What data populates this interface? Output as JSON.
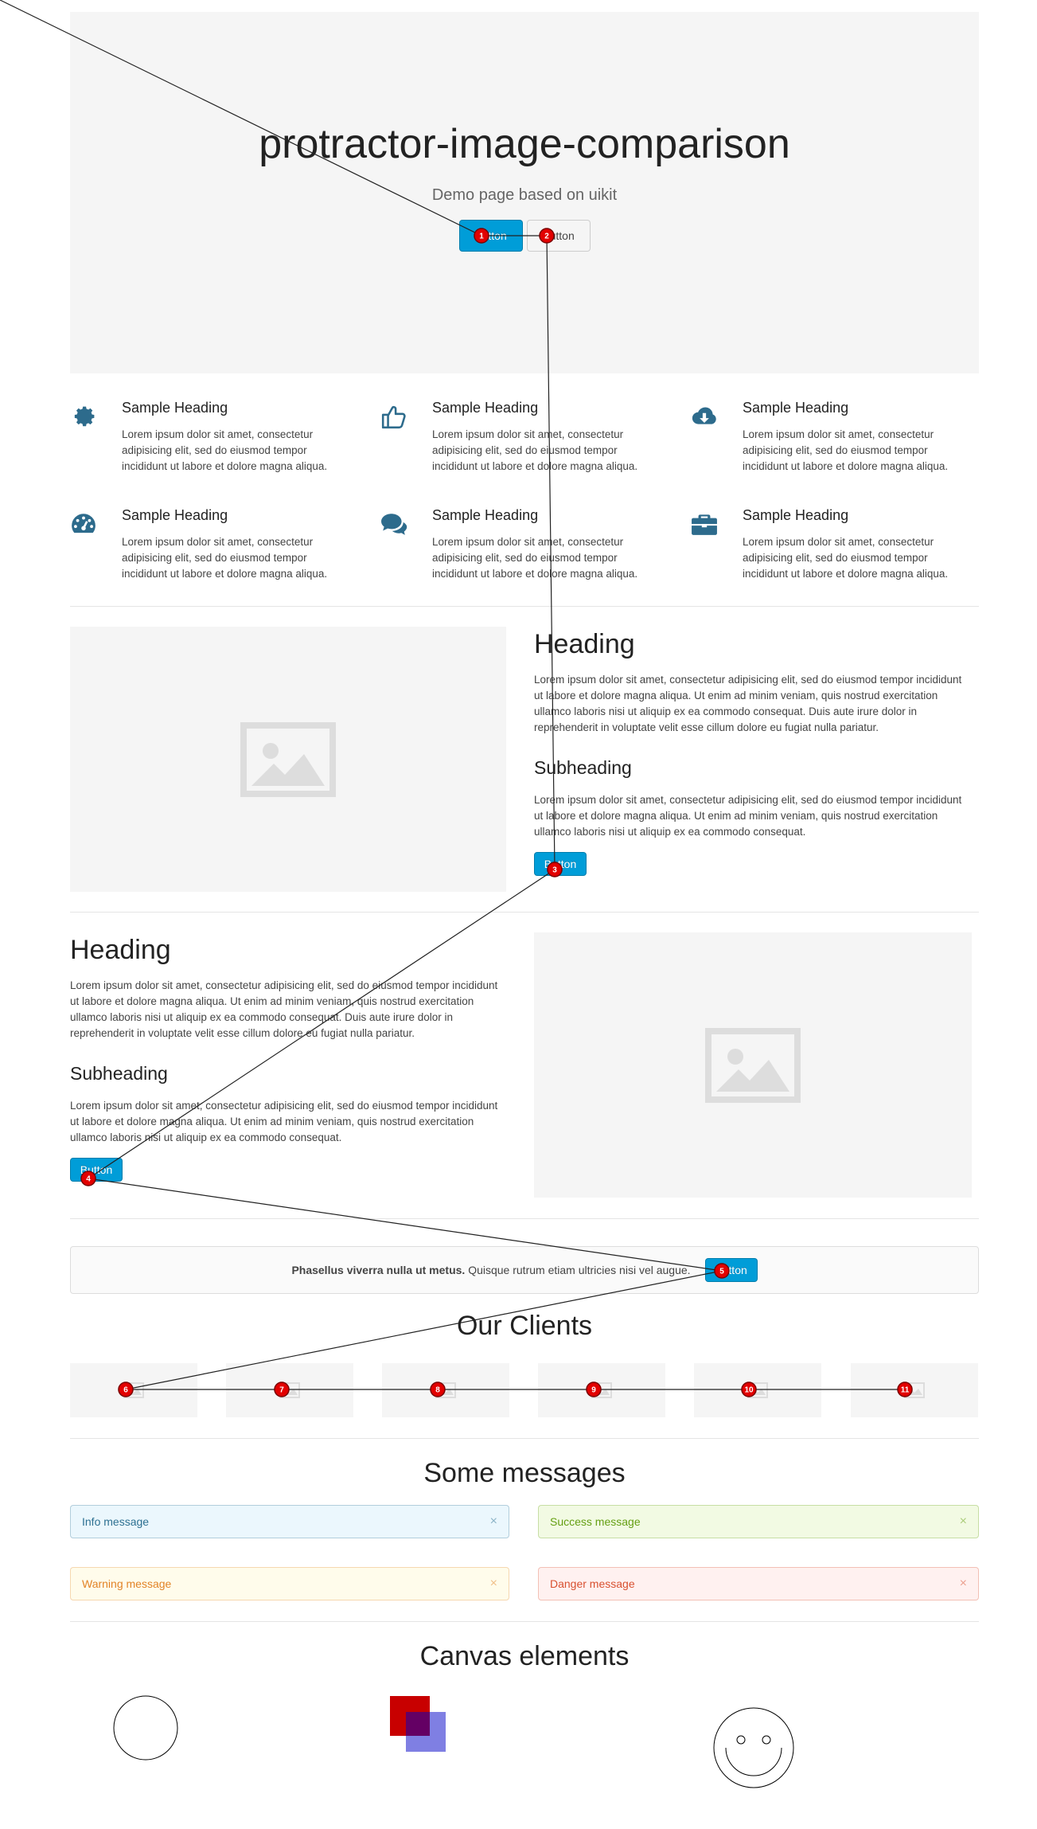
{
  "hero": {
    "title": "protractor-image-comparison",
    "subtitle": "Demo page based on uikit",
    "primary_button": "Button",
    "default_button": "Button"
  },
  "features": [
    {
      "icon": "gear-icon",
      "heading": "Sample Heading",
      "text": "Lorem ipsum dolor sit amet, consectetur adipisicing elit, sed do eiusmod tempor incididunt ut labore et dolore magna aliqua."
    },
    {
      "icon": "thumbs-up-icon",
      "heading": "Sample Heading",
      "text": "Lorem ipsum dolor sit amet, consectetur adipisicing elit, sed do eiusmod tempor incididunt ut labore et dolore magna aliqua."
    },
    {
      "icon": "cloud-download-icon",
      "heading": "Sample Heading",
      "text": "Lorem ipsum dolor sit amet, consectetur adipisicing elit, sed do eiusmod tempor incididunt ut labore et dolore magna aliqua."
    },
    {
      "icon": "dashboard-icon",
      "heading": "Sample Heading",
      "text": "Lorem ipsum dolor sit amet, consectetur adipisicing elit, sed do eiusmod tempor incididunt ut labore et dolore magna aliqua."
    },
    {
      "icon": "comments-icon",
      "heading": "Sample Heading",
      "text": "Lorem ipsum dolor sit amet, consectetur adipisicing elit, sed do eiusmod tempor incididunt ut labore et dolore magna aliqua."
    },
    {
      "icon": "briefcase-icon",
      "heading": "Sample Heading",
      "text": "Lorem ipsum dolor sit amet, consectetur adipisicing elit, sed do eiusmod tempor incididunt ut labore et dolore magna aliqua."
    }
  ],
  "section1": {
    "heading": "Heading",
    "paragraph": "Lorem ipsum dolor sit amet, consectetur adipisicing elit, sed do eiusmod tempor incididunt ut labore et dolore magna aliqua. Ut enim ad minim veniam, quis nostrud exercitation ullamco laboris nisi ut aliquip ex ea commodo consequat. Duis aute irure dolor in reprehenderit in voluptate velit esse cillum dolore eu fugiat nulla pariatur.",
    "subheading": "Subheading",
    "sub_paragraph": "Lorem ipsum dolor sit amet, consectetur adipisicing elit, sed do eiusmod tempor incididunt ut labore et dolore magna aliqua. Ut enim ad minim veniam, quis nostrud exercitation ullamco laboris nisi ut aliquip ex ea commodo consequat.",
    "button": "Button"
  },
  "section2": {
    "heading": "Heading",
    "paragraph": "Lorem ipsum dolor sit amet, consectetur adipisicing elit, sed do eiusmod tempor incididunt ut labore et dolore magna aliqua. Ut enim ad minim veniam, quis nostrud exercitation ullamco laboris nisi ut aliquip ex ea commodo consequat. Duis aute irure dolor in reprehenderit in voluptate velit esse cillum dolore eu fugiat nulla pariatur.",
    "subheading": "Subheading",
    "sub_paragraph": "Lorem ipsum dolor sit amet, consectetur adipisicing elit, sed do eiusmod tempor incididunt ut labore et dolore magna aliqua. Ut enim ad minim veniam, quis nostrud exercitation ullamco laboris nisi ut aliquip ex ea commodo consequat.",
    "button": "Button"
  },
  "panel": {
    "bold": "Phasellus viverra nulla ut metus.",
    "text": " Quisque rutrum etiam ultricies nisi vel augue.",
    "button": "Button"
  },
  "clients": {
    "heading": "Our Clients"
  },
  "messages": {
    "heading": "Some messages",
    "info": "Info message",
    "success": "Success message",
    "warning": "Warning message",
    "danger": "Danger message",
    "close": "×"
  },
  "canvas": {
    "heading": "Canvas elements"
  },
  "markers": [
    "1",
    "2",
    "3",
    "4",
    "5",
    "6",
    "7",
    "8",
    "9",
    "10",
    "11"
  ],
  "colors": {
    "primary": "#009dd8",
    "icon": "#2d6b8c",
    "marker": "#e20000"
  }
}
